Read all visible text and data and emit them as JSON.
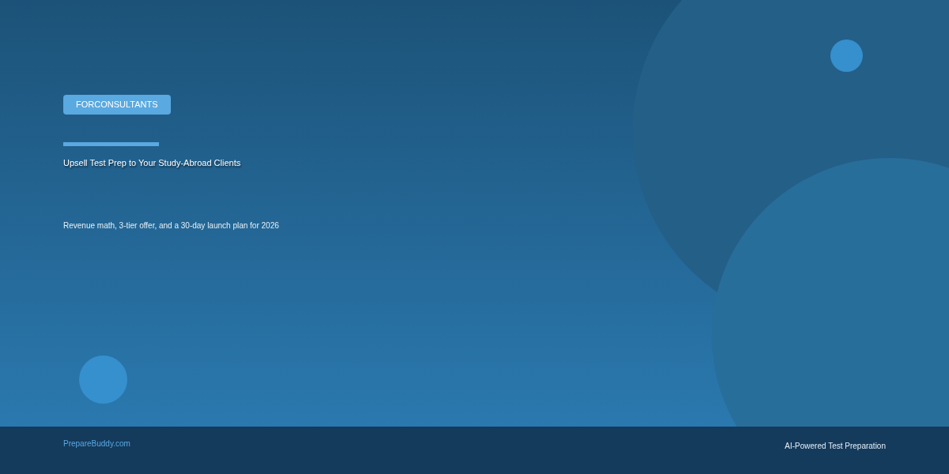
{
  "badge": "FORCONSULTANTS",
  "title": "Upsell Test Prep to Your Study-Abroad Clients",
  "subtitle": "Revenue math, 3-tier offer, and a 30-day launch plan for 2026",
  "footer": {
    "site_link": "PrepareBuddy.com",
    "tagline": "AI-Powered Test Preparation"
  }
}
